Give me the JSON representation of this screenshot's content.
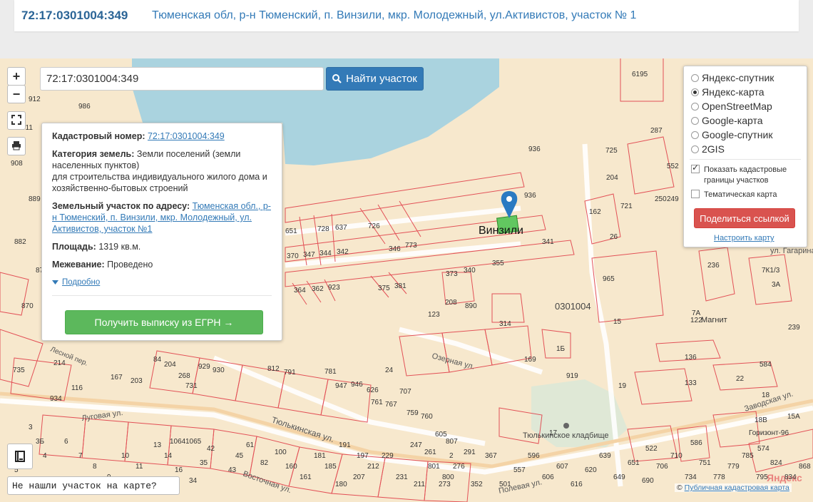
{
  "header": {
    "cadastral_number": "72:17:0301004:349",
    "address": "Тюменская обл, р-н Тюменский, п. Винзили, мкр. Молодежный, ул.Активистов, участок № 1"
  },
  "map_controls": {
    "zoom_in": "+",
    "zoom_out": "−",
    "fullscreen_icon": "fullscreen-icon",
    "print_icon": "print-icon"
  },
  "search": {
    "value": "72:17:0301004:349",
    "button_label": "Найти участок"
  },
  "info_panel": {
    "cadastral_label": "Кадастровый номер:",
    "cadastral_value": "72:17:0301004:349",
    "category_label": "Категория земель:",
    "category_value": "Земли поселений (земли населенных пунктов)",
    "purpose": "для строительства индивидуального жилого дома и хозяйственно-бытовых строений",
    "address_label": "Земельный участок по адресу:",
    "address_value": "Тюменская обл., р-н Тюменский, п. Винзили, мкр. Молодежный, ул. Активистов, участок №1",
    "area_label": "Площадь:",
    "area_value": "1319 кв.м.",
    "survey_label": "Межевание:",
    "survey_value": "Проведено",
    "details_link": "Подробно",
    "egrn_button": "Получить выписку из ЕГРН →"
  },
  "layers_panel": {
    "base_layers": [
      {
        "label": "Яндекс-спутник",
        "selected": false
      },
      {
        "label": "Яндекс-карта",
        "selected": true
      },
      {
        "label": "OpenStreetMap",
        "selected": false
      },
      {
        "label": "Google-карта",
        "selected": false
      },
      {
        "label": "Google-спутник",
        "selected": false
      },
      {
        "label": "2GIS",
        "selected": false
      }
    ],
    "show_cadastral": {
      "label": "Показать кадастровые границы участков",
      "checked": true
    },
    "thematic": {
      "label": "Тематическая карта",
      "checked": false
    },
    "share_button": "Поделиться ссылкой",
    "configure_link": "Настроить карту"
  },
  "map_labels": {
    "settlement": "Винзили",
    "quarter": "0301004",
    "cemetery": "Тюлькинское кладбище",
    "street_tyulkinskaya": "Тюлькинская ул.",
    "street_lugovaya": "Луговая ул.",
    "street_vostochnaya": "Восточная ул.",
    "street_ozernaya": "Озерная ул.",
    "street_zavodskaya": "Заводская ул.",
    "street_gagarina": "ул. Гагарина",
    "street_polevaya": "Полевая ул.",
    "street_lesnoy": "Лесной пер.",
    "magnit": "Магнит",
    "gorizont": "Горизонт-96",
    "yandex_logo": "Яндекс",
    "parcel_numbers": [
      "6195",
      "936",
      "936",
      "725",
      "204",
      "162",
      "721",
      "287",
      "552",
      "250",
      "249",
      "26",
      "651",
      "728",
      "637",
      "726",
      "370",
      "347",
      "344",
      "342",
      "346",
      "773",
      "373",
      "340",
      "355",
      "341",
      "965",
      "364",
      "362",
      "923",
      "375",
      "381",
      "208",
      "890",
      "314",
      "123",
      "236",
      "7К1/3",
      "3А",
      "15",
      "122",
      "7А",
      "239",
      "136",
      "22",
      "133",
      "584",
      "18",
      "18В",
      "15А",
      "574",
      "522",
      "586",
      "17",
      "1Б",
      "919",
      "19",
      "24",
      "84",
      "214",
      "169",
      "735",
      "934",
      "116",
      "167",
      "203",
      "204",
      "268",
      "731",
      "929",
      "930",
      "812",
      "791",
      "781",
      "947",
      "946",
      "626",
      "761",
      "767",
      "707",
      "759",
      "760",
      "1064",
      "1065",
      "605",
      "807",
      "180",
      "197",
      "211",
      "801",
      "800",
      "2",
      "3",
      "3Б",
      "4",
      "5",
      "6",
      "7",
      "8",
      "9",
      "10",
      "11",
      "12",
      "13",
      "14",
      "16",
      "34",
      "35",
      "42",
      "43",
      "45",
      "61",
      "82",
      "100",
      "160",
      "161",
      "181",
      "185",
      "191",
      "207",
      "212",
      "229",
      "231",
      "247",
      "261",
      "273",
      "276",
      "291",
      "352",
      "367",
      "501",
      "557",
      "596",
      "606",
      "607",
      "616",
      "620",
      "639",
      "649",
      "651",
      "690",
      "706",
      "710",
      "734",
      "751",
      "778",
      "779",
      "785",
      "795",
      "824",
      "834",
      "868",
      "870",
      "877",
      "882",
      "889",
      "908",
      "911",
      "912",
      "969",
      "986",
      "1004"
    ]
  },
  "bottom": {
    "not_found": "Не нашли участок на карте?",
    "book_icon": "book-icon",
    "attribution_prefix": "© ",
    "attribution_link": "Публичная кадастровая карта"
  }
}
